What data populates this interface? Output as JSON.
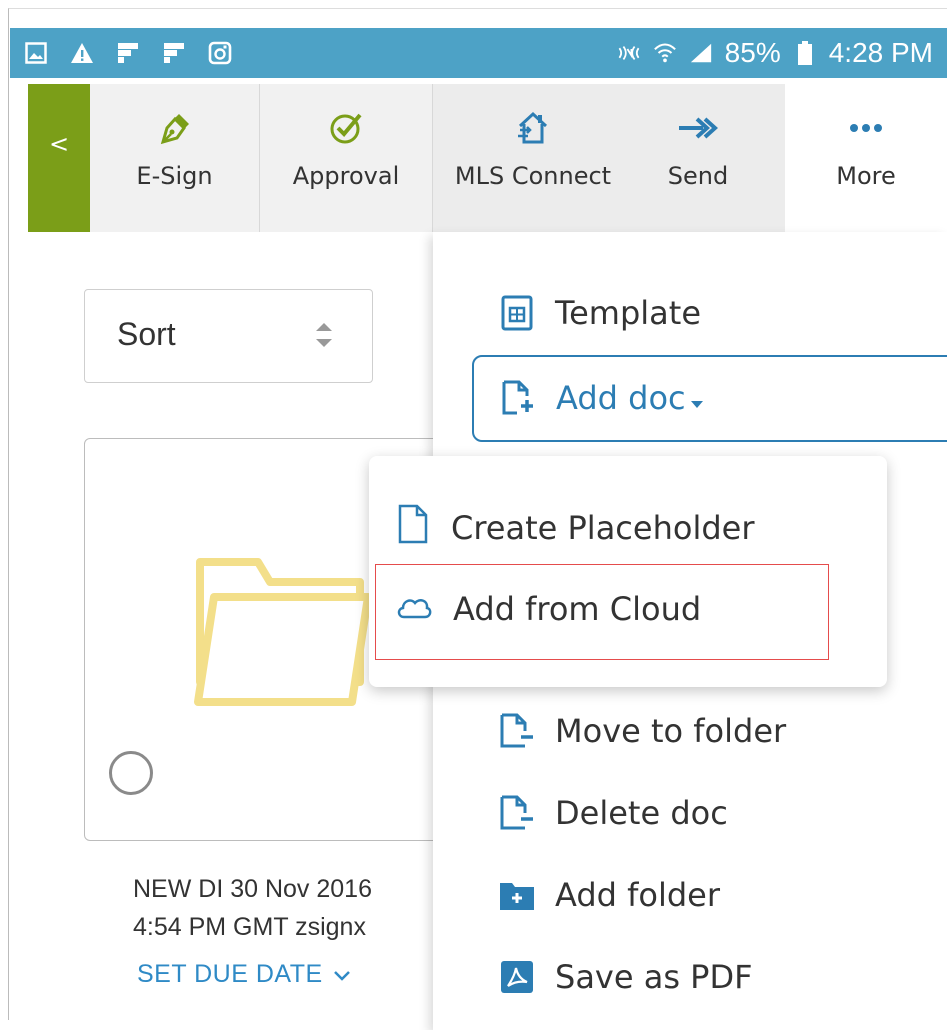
{
  "status_bar": {
    "battery": "85%",
    "time": "4:28 PM",
    "left_icons": [
      "image-icon",
      "warning-icon",
      "flipboard-icon",
      "flipboard-icon",
      "instagram-icon"
    ],
    "right_icons": [
      "nfc-icon",
      "wifi-icon",
      "signal-icon",
      "battery-icon"
    ]
  },
  "toolbar": {
    "back_label": "<",
    "items": [
      {
        "label": "E-Sign",
        "icon": "pen-nib-icon"
      },
      {
        "label": "Approval",
        "icon": "check-circle-icon"
      },
      {
        "label": "MLS Connect",
        "icon": "house-exchange-icon"
      },
      {
        "label": "Send",
        "icon": "send-arrow-icon"
      },
      {
        "label": "More",
        "icon": "more-dots-icon"
      }
    ]
  },
  "sort": {
    "label": "Sort"
  },
  "card": {
    "caption_line1": "NEW DI 30 Nov 2016",
    "caption_line2": "4:54 PM GMT zsignx",
    "due_date_label": "SET DUE DATE"
  },
  "menu": {
    "template_label": "Template",
    "add_doc_label": "Add doc",
    "move_label": "Move to folder",
    "delete_label": "Delete doc",
    "add_folder_label": "Add folder",
    "save_pdf_label": "Save as PDF"
  },
  "submenu": {
    "create_placeholder_label": "Create Placeholder",
    "add_from_cloud_label": "Add from Cloud"
  },
  "colors": {
    "status_bar": "#4da2c6",
    "back_button": "#7b9e18",
    "accent": "#2c7db3",
    "highlight": "#e54c4c",
    "folder": "#f3df8a"
  }
}
